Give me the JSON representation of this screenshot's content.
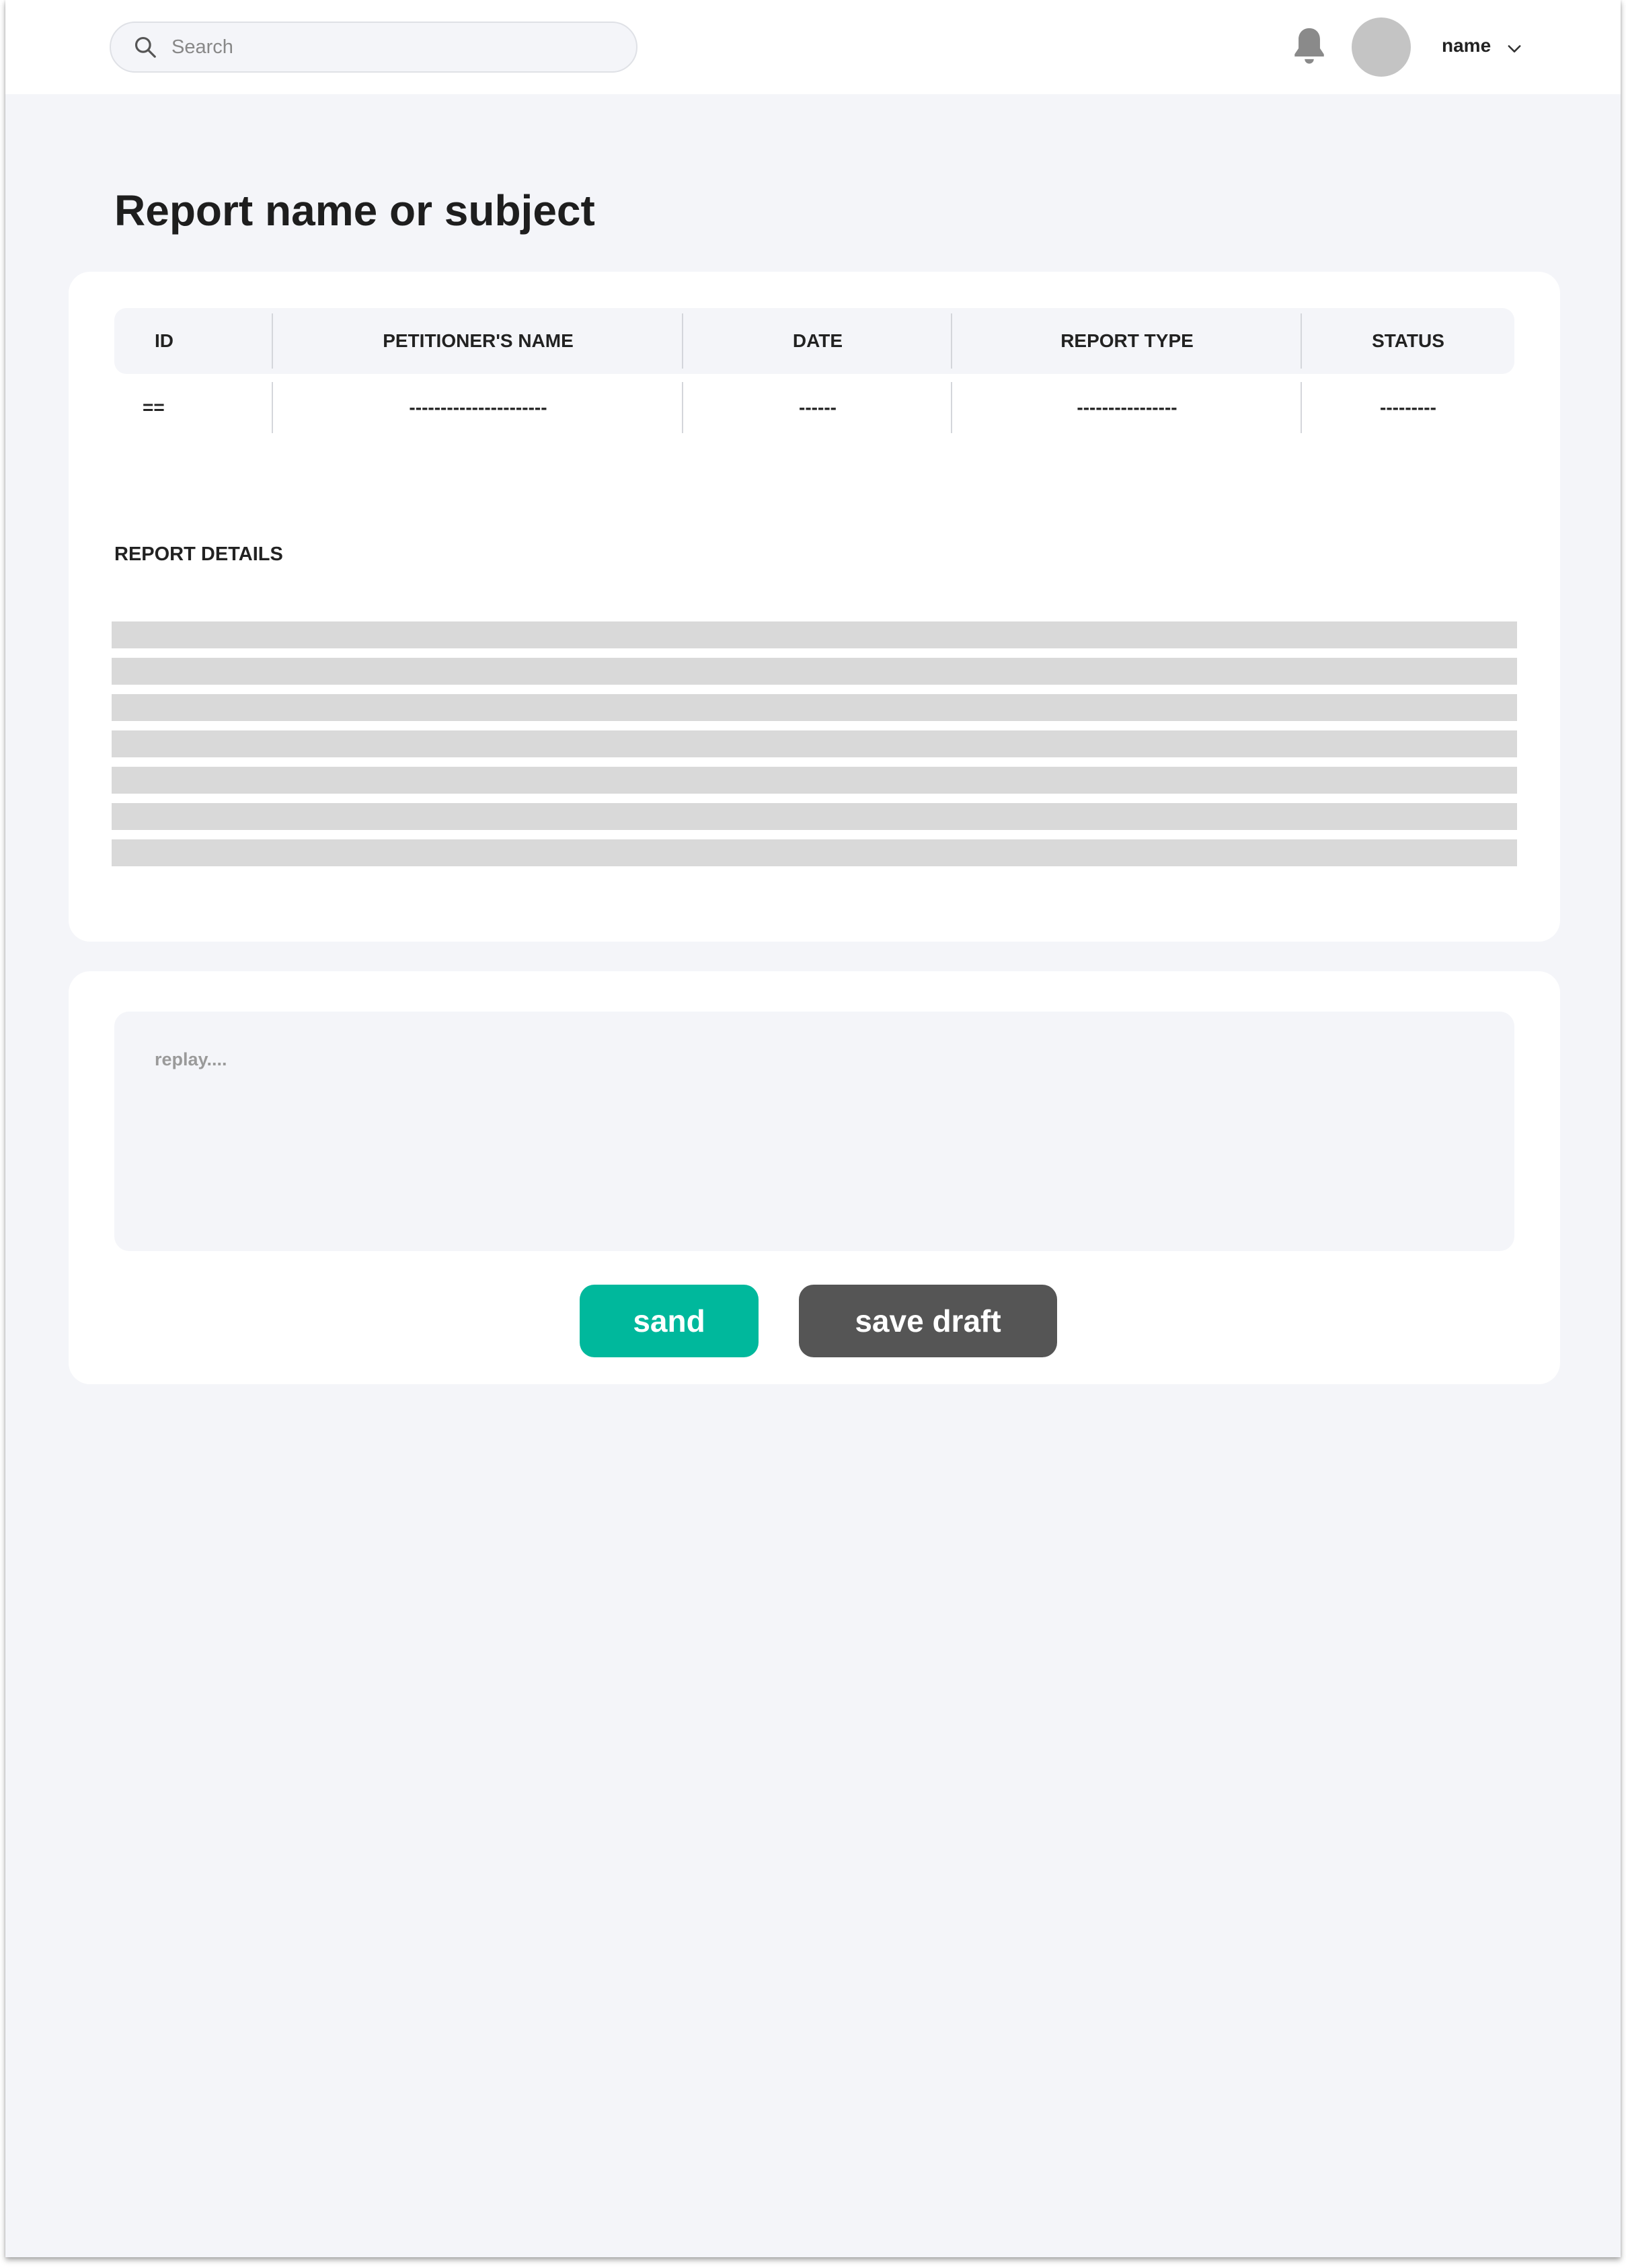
{
  "header": {
    "search": {
      "placeholder": "Search",
      "value": ""
    },
    "user": {
      "name": "name"
    },
    "icons": {
      "search": "search-icon",
      "bell": "bell-icon",
      "chevron": "chevron-down-icon"
    }
  },
  "page": {
    "title": "Report name or subject"
  },
  "report_table": {
    "columns": [
      "ID",
      "PETITIONER'S NAME",
      "DATE",
      "REPORT TYPE",
      "STATUS"
    ],
    "row": [
      "==",
      "----------------------",
      "------",
      "----------------",
      "---------"
    ]
  },
  "report_details": {
    "label": "REPORT DETAILS"
  },
  "reply": {
    "placeholder": "replay....",
    "value": "",
    "send_label": "sand",
    "draft_label": "save draft"
  },
  "colors": {
    "page_bg": "#f4f5f9",
    "card_bg": "#ffffff",
    "send_button": "#00b89c",
    "draft_button": "#555555",
    "skeleton": "#d9d9d9",
    "avatar": "#c4c4c4",
    "bell": "#8a8a8a"
  }
}
